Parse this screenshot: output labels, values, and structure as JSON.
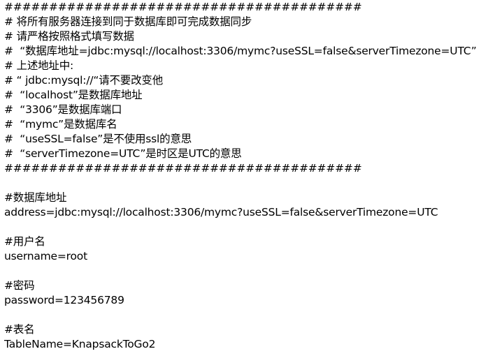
{
  "lines": [
    "########################################",
    "# 将所有服务器连接到同于数据库即可完成数据同步",
    "# 请严格按照格式填写数据",
    "#  “数据库地址=jdbc:mysql://localhost:3306/mymc?useSSL=false&serverTimezone=UTC”",
    "# 上述地址中:",
    "# “ jdbc:mysql://“请不要改变他",
    "#  “localhost”是数据库地址",
    "#  “3306”是数据库端口",
    "#  “mymc”是数据库名",
    "#  “useSSL=false”是不使用ssl的意思",
    "#  “serverTimezone=UTC”是时区是UTC的意思",
    "########################################",
    "",
    "#数据库地址",
    "address=jdbc:mysql://localhost:3306/mymc?useSSL=false&serverTimezone=UTC",
    "",
    "#用户名",
    "username=root",
    "",
    "#密码",
    "password=123456789",
    "",
    "#表名",
    "TableName=KnapsackToGo2"
  ]
}
